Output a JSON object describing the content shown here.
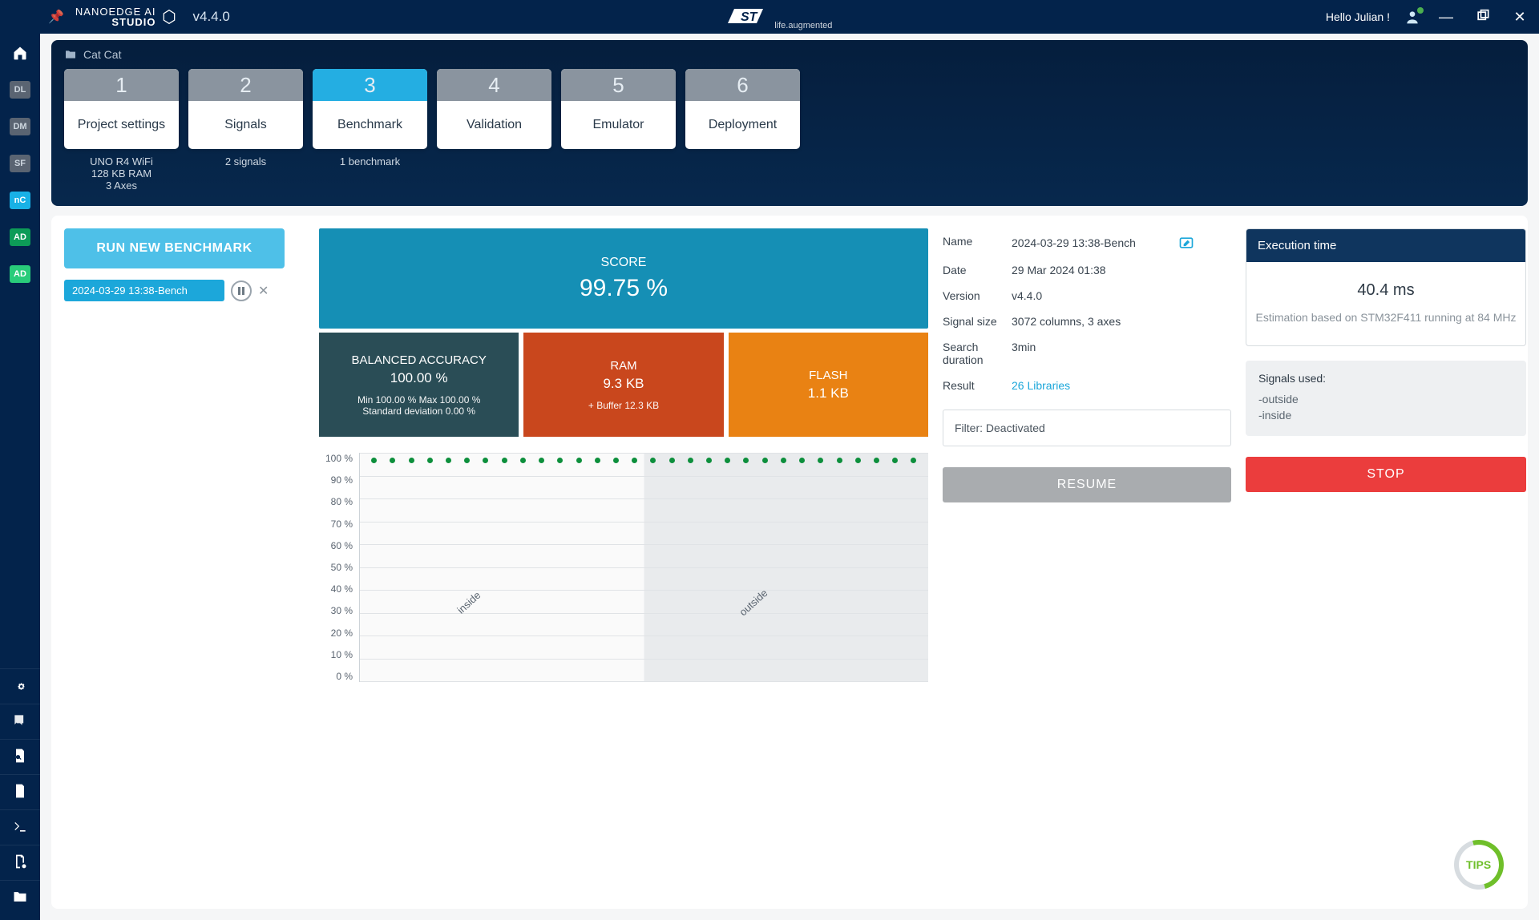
{
  "titlebar": {
    "brand_top": "NANOEDGE AI",
    "brand_bot": "STUDIO",
    "version": "v4.4.0",
    "st_logo": "ST",
    "st_sub": "life.augmented",
    "hello": "Hello Julian !"
  },
  "sidebar": {
    "tags": [
      "DL",
      "DM",
      "SF",
      "nC",
      "AD",
      "AD"
    ]
  },
  "breadcrumb": {
    "project": "Cat Cat"
  },
  "steps": [
    {
      "num": "1",
      "label": "Project settings",
      "sub": "UNO R4 WiFi\n128 KB RAM\n3 Axes",
      "active": false
    },
    {
      "num": "2",
      "label": "Signals",
      "sub": "2 signals",
      "active": false
    },
    {
      "num": "3",
      "label": "Benchmark",
      "sub": "1 benchmark",
      "active": true
    },
    {
      "num": "4",
      "label": "Validation",
      "sub": "",
      "active": false
    },
    {
      "num": "5",
      "label": "Emulator",
      "sub": "",
      "active": false
    },
    {
      "num": "6",
      "label": "Deployment",
      "sub": "",
      "active": false
    }
  ],
  "col1": {
    "run_label": "RUN NEW BENCHMARK",
    "bench_name": "2024-03-29 13:38-Bench"
  },
  "metrics": {
    "score_label": "SCORE",
    "score_value": "99.75 %",
    "acc_label": "BALANCED ACCURACY",
    "acc_value": "100.00 %",
    "acc_sub1": "Min 100.00 % Max 100.00 %",
    "acc_sub2": "Standard deviation 0.00 %",
    "ram_label": "RAM",
    "ram_value": "9.3 KB",
    "ram_sub": "+ Buffer 12.3 KB",
    "flash_label": "FLASH",
    "flash_value": "1.1 KB"
  },
  "chart_data": {
    "type": "scatter",
    "y_ticks": [
      "100 %",
      "90 %",
      "80 %",
      "70 %",
      "60 %",
      "50 %",
      "40 %",
      "30 %",
      "20 %",
      "10 %",
      "0 %"
    ],
    "categories": [
      "inside",
      "outside"
    ],
    "n_points": 30,
    "series": [
      {
        "name": "accuracy",
        "values_pct": [
          100,
          100,
          100,
          100,
          100,
          100,
          100,
          100,
          100,
          100,
          100,
          100,
          100,
          100,
          100,
          100,
          100,
          100,
          100,
          100,
          100,
          100,
          100,
          100,
          100,
          100,
          100,
          100,
          100,
          100
        ]
      }
    ],
    "ylim": [
      0,
      100
    ]
  },
  "info": {
    "name_label": "Name",
    "name_value": "2024-03-29 13:38-Bench",
    "date_label": "Date",
    "date_value": "29 Mar 2024 01:38",
    "version_label": "Version",
    "version_value": "v4.4.0",
    "size_label": "Signal size",
    "size_value": "3072 columns, 3 axes",
    "dur_label": "Search duration",
    "dur_value": "3min",
    "result_label": "Result",
    "result_value": "26 Libraries",
    "filter": "Filter: Deactivated",
    "resume_label": "RESUME"
  },
  "exec": {
    "title": "Execution time",
    "value": "40.4 ms",
    "note": "Estimation based on STM32F411 running at 84 MHz",
    "sig_title": "Signals used:",
    "sig1": "-outside",
    "sig2": "-inside",
    "stop_label": "STOP"
  },
  "tips": "TIPS"
}
